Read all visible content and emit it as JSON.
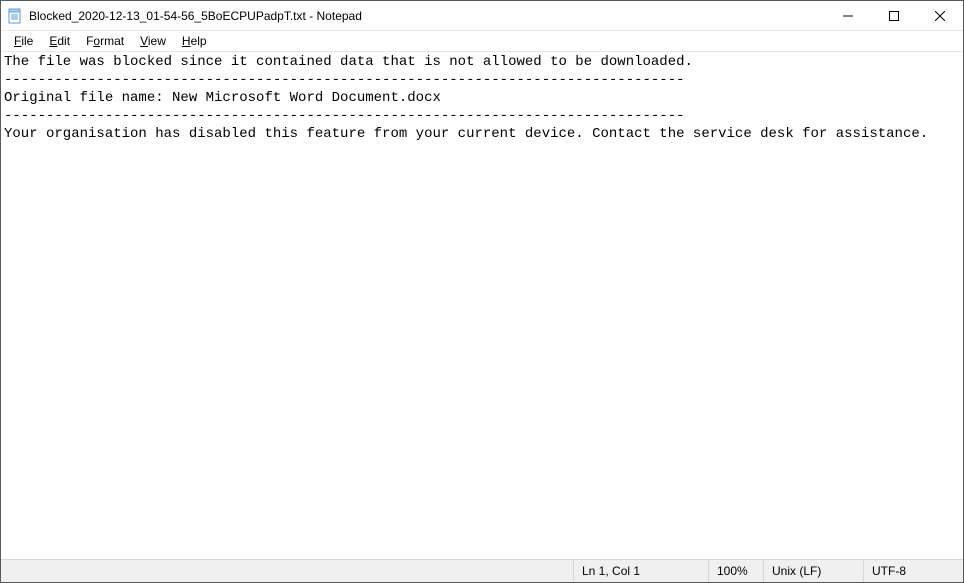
{
  "window": {
    "title": "Blocked_2020-12-13_01-54-56_5BoECPUPadpT.txt - Notepad"
  },
  "menu": {
    "file": "File",
    "edit": "Edit",
    "format": "Format",
    "view": "View",
    "help": "Help"
  },
  "document": {
    "content": "The file was blocked since it contained data that is not allowed to be downloaded.\n---------------------------------------------------------------------------------\nOriginal file name: New Microsoft Word Document.docx\n---------------------------------------------------------------------------------\nYour organisation has disabled this feature from your current device. Contact the service desk for assistance."
  },
  "status": {
    "position": "Ln 1, Col 1",
    "zoom": "100%",
    "line_ending": "Unix (LF)",
    "encoding": "UTF-8"
  }
}
